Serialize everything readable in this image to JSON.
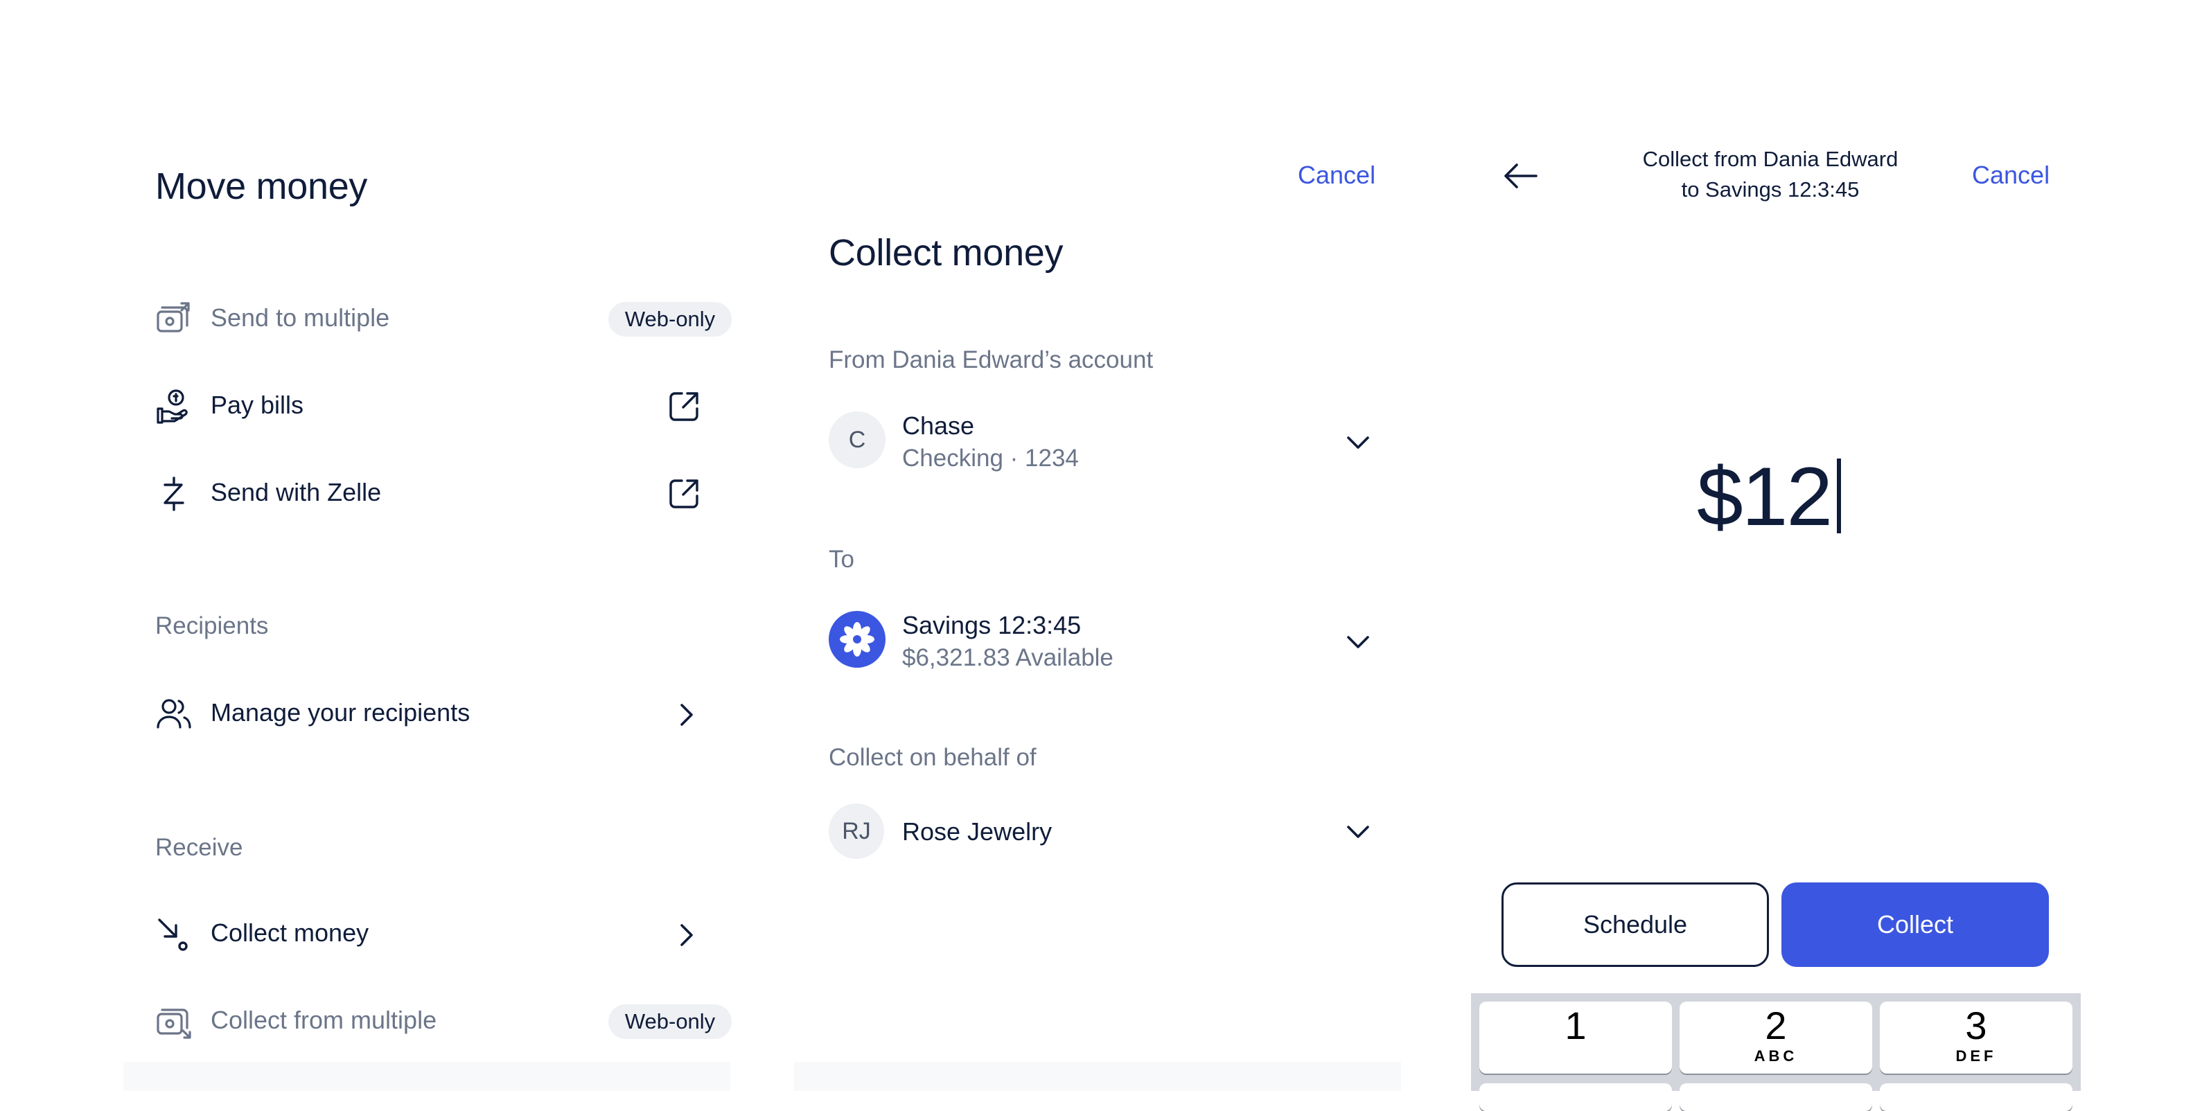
{
  "move_money": {
    "title": "Move money",
    "items": [
      {
        "label": "Send to multiple",
        "badge": "Web-only",
        "icon": "send-multiple-icon"
      },
      {
        "label": "Pay bills",
        "icon": "pay-bills-icon",
        "trailing": "external-link-icon"
      },
      {
        "label": "Send with Zelle",
        "icon": "zelle-icon",
        "trailing": "external-link-icon"
      }
    ],
    "recipients_label": "Recipients",
    "manage_recipients": "Manage your recipients",
    "receive_label": "Receive",
    "collect_money": "Collect money",
    "collect_multiple": "Collect from multiple",
    "collect_multiple_badge": "Web-only"
  },
  "collect_form": {
    "cancel": "Cancel",
    "title": "Collect money",
    "from_label": "From Dania Edward’s account",
    "from_avatar": "C",
    "from_name": "Chase",
    "from_sub": "Checking · 1234",
    "to_label": "To",
    "to_name": "Savings 12:3:45",
    "to_sub": "$6,321.83 Available",
    "behalf_label": "Collect on behalf of",
    "behalf_avatar": "RJ",
    "behalf_name": "Rose Jewelry"
  },
  "amount_entry": {
    "header_line1": "Collect from Dania Edward",
    "header_line2": "to Savings 12:3:45",
    "cancel": "Cancel",
    "amount": "$12",
    "schedule": "Schedule",
    "collect": "Collect",
    "keys": [
      {
        "num": "1",
        "letters": ""
      },
      {
        "num": "2",
        "letters": "ABC"
      },
      {
        "num": "3",
        "letters": "DEF"
      }
    ]
  },
  "colors": {
    "accent": "#3b56e0",
    "text": "#0f1c3a",
    "muted": "#6b7589",
    "badge_bg": "#eef0f3"
  }
}
